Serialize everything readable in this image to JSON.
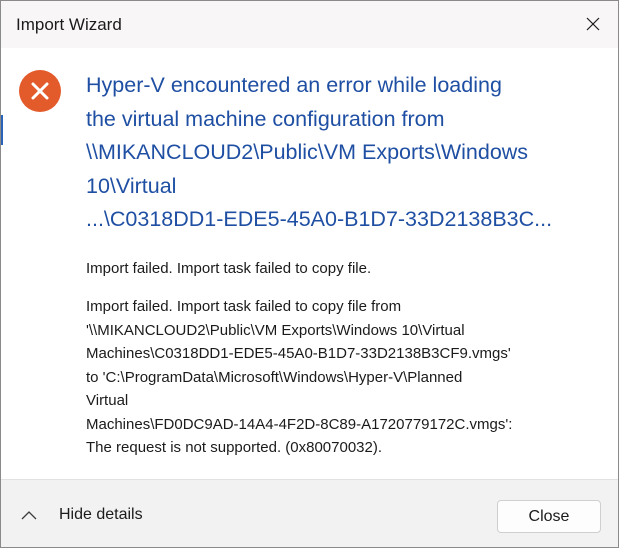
{
  "window": {
    "title": "Import Wizard",
    "close_icon": "close-icon"
  },
  "error": {
    "icon": "error-x-circle-icon",
    "icon_color": "#e35a2b",
    "headline_color": "#1f4fa3",
    "headline_lines": [
      "Hyper-V encountered an error while loading",
      "the virtual machine configuration from",
      "\\\\MIKANCLOUD2\\Public\\VM Exports\\Windows",
      "10\\Virtual",
      "...\\C0318DD1-EDE5-45A0-B1D7-33D2138B3C..."
    ]
  },
  "summary": "Import failed. Import task failed to copy file.",
  "details_lines": [
    "Import failed. Import task failed to copy file from",
    "'\\\\MIKANCLOUD2\\Public\\VM Exports\\Windows 10\\Virtual",
    "Machines\\C0318DD1-EDE5-45A0-B1D7-33D2138B3CF9.vmgs'",
    "to 'C:\\ProgramData\\Microsoft\\Windows\\Hyper-V\\Planned",
    "Virtual",
    "Machines\\FD0DC9AD-14A4-4F2D-8C89-A1720779172C.vmgs':",
    "The request is not supported. (0x80070032)."
  ],
  "footer": {
    "toggle_icon": "chevron-up-icon",
    "toggle_label": "Hide details",
    "close_label": "Close"
  }
}
